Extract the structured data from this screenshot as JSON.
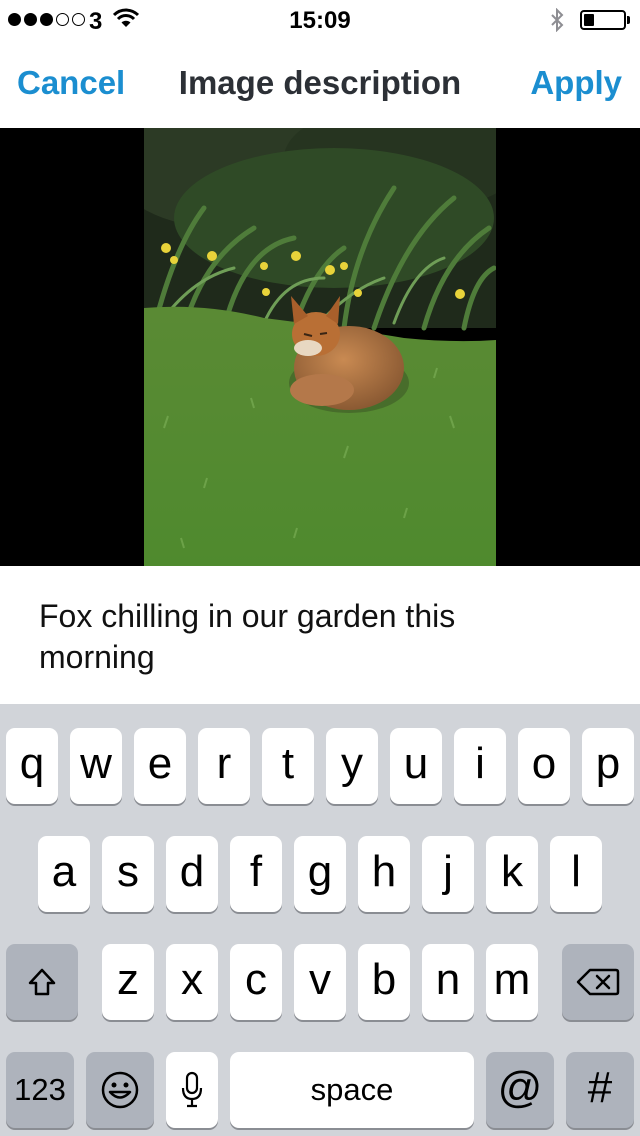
{
  "status_bar": {
    "carrier": "3",
    "time": "15:09",
    "signal_icon": "signal-dots-icon",
    "wifi_icon": "wifi-icon",
    "bluetooth_icon": "bluetooth-icon",
    "battery_icon": "battery-icon",
    "battery_level": 0.25
  },
  "nav": {
    "cancel_label": "Cancel",
    "title": "Image description",
    "apply_label": "Apply"
  },
  "description": {
    "text": "Fox chilling in our garden this morning"
  },
  "keyboard": {
    "row1": [
      "q",
      "w",
      "e",
      "r",
      "t",
      "y",
      "u",
      "i",
      "o",
      "p"
    ],
    "row2": [
      "a",
      "s",
      "d",
      "f",
      "g",
      "h",
      "j",
      "k",
      "l"
    ],
    "row3": [
      "z",
      "x",
      "c",
      "v",
      "b",
      "n",
      "m"
    ],
    "numbers_label": "123",
    "space_label": "space",
    "at_label": "@",
    "hash_label": "#",
    "shift_icon": "shift-arrow-icon",
    "delete_icon": "backspace-icon",
    "emoji_icon": "emoji-icon",
    "mic_icon": "microphone-icon"
  },
  "colors": {
    "accent": "#1b8ed0",
    "title": "#2c3036",
    "keyboard_bg": "#d1d4d9",
    "function_key": "#aeb3bc"
  }
}
